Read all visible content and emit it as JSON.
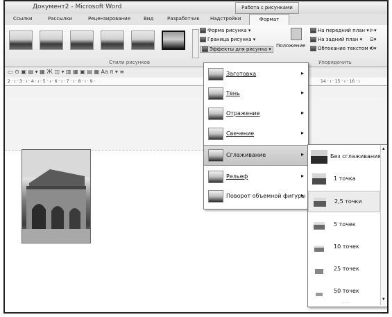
{
  "window": {
    "title": "Документ2 - Microsoft Word",
    "context_tab": "Работа с рисунками"
  },
  "tabs": [
    {
      "label": "Ссылки"
    },
    {
      "label": "Рассылки"
    },
    {
      "label": "Рецензирование"
    },
    {
      "label": "Вид"
    },
    {
      "label": "Разработчик"
    },
    {
      "label": "Надстройки"
    }
  ],
  "active_tab": "Формат",
  "ribbon": {
    "picture_styles": {
      "group_label": "Стили рисунков",
      "shape_label": "Форма рисунка",
      "border_label": "Граница рисунка",
      "effects_label": "Эффекты для рисунка"
    },
    "arrange": {
      "group_label": "Упорядочить",
      "position_label": "Положение",
      "bring_front_label": "На передний план",
      "send_back_label": "На задний план",
      "wrap_label": "Обтекание текстом"
    }
  },
  "ruler": {
    "left_text": "2 · ı · 3 · ı · 4 · ı · 5 · ı · 6 · ı · 7 · ı · 8 · ı · 9 ·",
    "right_text": "14 · ı · 15 · ı · 16 · ı"
  },
  "effects_menu": {
    "items": [
      {
        "label": "Заготовка"
      },
      {
        "label": "Тень"
      },
      {
        "label": "Отражение"
      },
      {
        "label": "Свечение"
      },
      {
        "label": "Сглаживание"
      },
      {
        "label": "Рельеф"
      },
      {
        "label": "Поворот объемной фигуры"
      }
    ],
    "highlighted_index": 4
  },
  "soft_edges_menu": {
    "items": [
      {
        "label": "Без сглаживания"
      },
      {
        "label": "1 точка"
      },
      {
        "label": "2,5 точки"
      },
      {
        "label": "5 точек"
      },
      {
        "label": "10 точек"
      },
      {
        "label": "25 точек"
      },
      {
        "label": "50 точек"
      }
    ],
    "highlighted_index": 2
  }
}
